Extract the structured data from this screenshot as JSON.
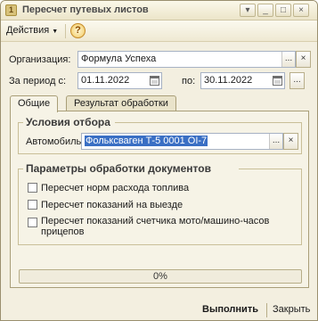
{
  "window": {
    "title": "Пересчет путевых листов",
    "controls": {
      "menu": "▾",
      "minimize": "_",
      "maximize": "□",
      "close": "×"
    }
  },
  "toolbar": {
    "actions_label": "Действия",
    "help_glyph": "?"
  },
  "form": {
    "organization": {
      "label": "Организация:",
      "value": "Формула Успеха"
    },
    "period": {
      "from_label": "За период с:",
      "from_value": "01.11.2022",
      "to_label": "по:",
      "to_value": "30.11.2022"
    },
    "ellipsis": "...",
    "clear": "×"
  },
  "tabs": [
    {
      "label": "Общие",
      "active": true
    },
    {
      "label": "Результат обработки",
      "active": false
    }
  ],
  "filter_group": {
    "title": "Условия отбора",
    "car_label": "Автомобиль:",
    "car_value": "Фольксваген Т-5 0001 ОI-7"
  },
  "processing_group": {
    "title": "Параметры обработки документов",
    "options": [
      {
        "label": "Пересчет норм расхода топлива",
        "checked": false
      },
      {
        "label": "Пересчет показаний на выезде",
        "checked": false
      },
      {
        "label": "Пересчет показаний счетчика мото/машино-часов прицепов",
        "checked": false
      }
    ]
  },
  "progress": {
    "value": 0,
    "text": "0%"
  },
  "buttons": {
    "run": "Выполнить",
    "close": "Закрыть"
  },
  "colors": {
    "selection": "#3a6fc4",
    "group_title": "#3a3a3a",
    "window_bg": "#f3efe0"
  }
}
